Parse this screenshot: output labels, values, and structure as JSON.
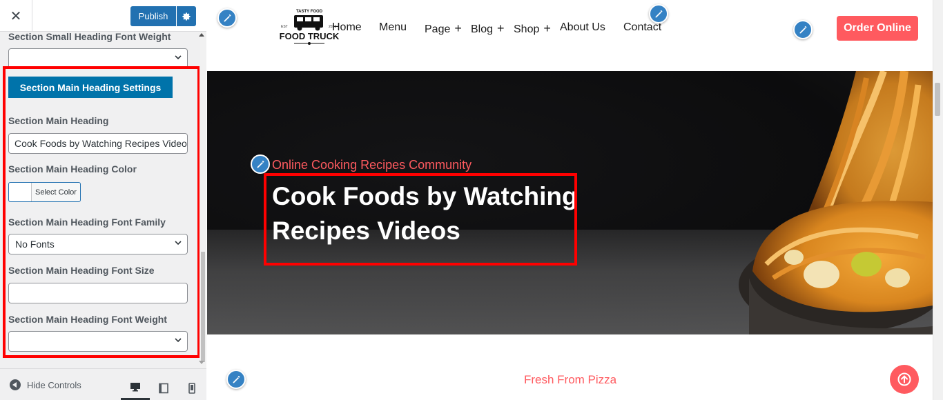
{
  "panel": {
    "close_icon": "close-icon",
    "publish_label": "Publish",
    "settings_icon": "gear-icon",
    "small_heading_font_weight_label": "Section Small Heading Font Weight",
    "small_heading_font_weight_value": "",
    "section_button_label": "Section Main Heading Settings",
    "main_heading_label": "Section Main Heading",
    "main_heading_value": "Cook Foods by Watching Recipes Videos",
    "main_heading_color_label": "Section Main Heading Color",
    "select_color_label": "Select Color",
    "font_family_label": "Section Main Heading Font Family",
    "font_family_value": "No Fonts",
    "font_size_label": "Section Main Heading Font Size",
    "font_size_value": "",
    "font_weight_label": "Section Main Heading Font Weight",
    "font_weight_value": "",
    "hide_controls_label": "Hide Controls",
    "devices": [
      "desktop",
      "tablet",
      "mobile"
    ],
    "active_device": "desktop"
  },
  "site": {
    "logo": {
      "top_text": "TASTY FOOD",
      "main_text": "FOOD TRUCK",
      "est_left": "EST",
      "est_right": "2021"
    },
    "nav": [
      {
        "label": "Home",
        "has_plus": false
      },
      {
        "label": "Menu",
        "has_plus": false
      },
      {
        "label": "Page",
        "has_plus": true
      },
      {
        "label": "Blog",
        "has_plus": true
      },
      {
        "label": "Shop",
        "has_plus": true
      },
      {
        "label": "About Us",
        "has_plus": false
      },
      {
        "label": "Contact",
        "has_plus": false
      }
    ],
    "plus_symbol": "+",
    "order_label": "Order Online",
    "hero": {
      "subtitle": "Online Cooking Recipes Community",
      "title": "Cook Foods by Watching Recipes Videos"
    },
    "section_label": "Fresh From Pizza"
  },
  "colors": {
    "accent": "#ff5a5f",
    "wp_blue": "#2271b1",
    "section_button": "#0073aa",
    "highlight": "#ff0000"
  }
}
